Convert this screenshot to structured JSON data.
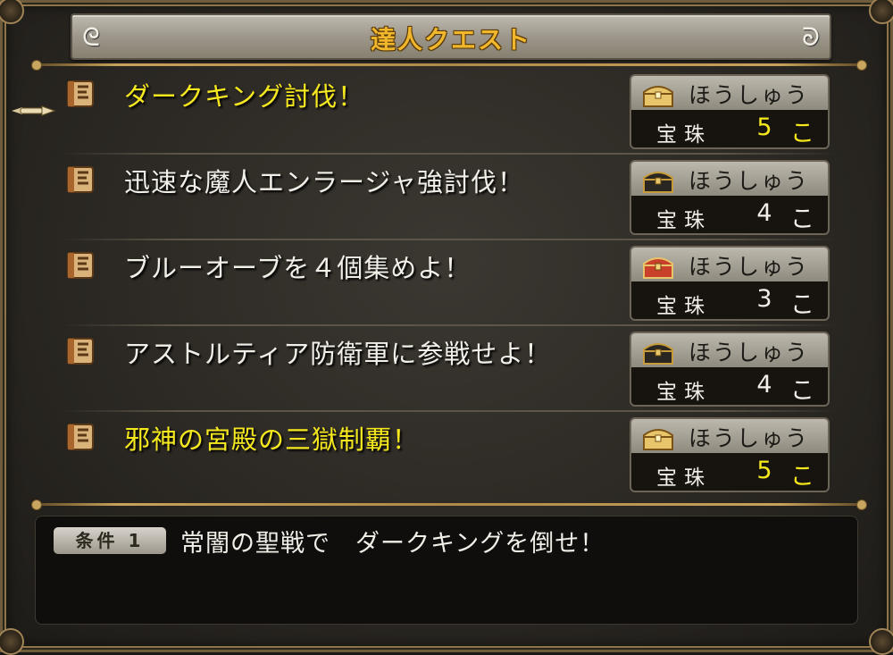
{
  "title": "達人クエスト",
  "reward_header": "ほうしゅう",
  "quests": [
    {
      "name": "ダークキング討伐！",
      "highlight": true,
      "reward_item": "宝珠",
      "reward_count": "5",
      "reward_unit": "こ",
      "count_gold": true,
      "chest": "gold-chest-icon"
    },
    {
      "name": "迅速な魔人エンラージャ強討伐！",
      "highlight": false,
      "reward_item": "宝珠",
      "reward_count": "4",
      "reward_unit": "こ",
      "count_gold": false,
      "chest": "black-chest-icon"
    },
    {
      "name": "ブルーオーブを４個集めよ！",
      "highlight": false,
      "reward_item": "宝珠",
      "reward_count": "3",
      "reward_unit": "こ",
      "count_gold": false,
      "chest": "red-chest-icon"
    },
    {
      "name": "アストルティア防衛軍に参戦せよ！",
      "highlight": false,
      "reward_item": "宝珠",
      "reward_count": "4",
      "reward_unit": "こ",
      "count_gold": false,
      "chest": "black-chest-icon"
    },
    {
      "name": "邪神の宮殿の三獄制覇！",
      "highlight": true,
      "reward_item": "宝珠",
      "reward_count": "5",
      "reward_unit": "こ",
      "count_gold": true,
      "chest": "gold-chest-icon"
    }
  ],
  "condition": {
    "badge": "条件 1",
    "text": "常闇の聖戦で　ダークキングを倒せ！"
  },
  "colors": {
    "highlight": "#f5e81f",
    "title": "#f0b72d",
    "normal_text": "#f1efe8"
  }
}
